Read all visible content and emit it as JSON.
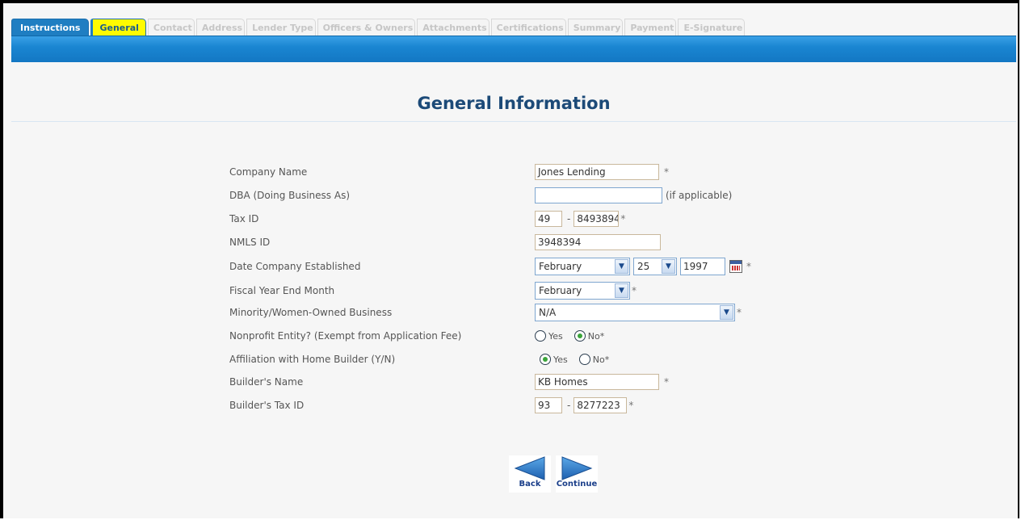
{
  "tabs": [
    {
      "label": "Instructions",
      "state": "enabled"
    },
    {
      "label": "General",
      "state": "current"
    },
    {
      "label": "Contact",
      "state": "disabled"
    },
    {
      "label": "Address",
      "state": "disabled"
    },
    {
      "label": "Lender Type",
      "state": "disabled"
    },
    {
      "label": "Officers & Owners",
      "state": "disabled"
    },
    {
      "label": "Attachments",
      "state": "disabled"
    },
    {
      "label": "Certifications",
      "state": "disabled"
    },
    {
      "label": "Summary",
      "state": "disabled"
    },
    {
      "label": "Payment",
      "state": "disabled"
    },
    {
      "label": "E-Signature",
      "state": "disabled"
    }
  ],
  "page_title": "General Information",
  "form": {
    "company_name": {
      "label": "Company Name",
      "value": "Jones Lending",
      "required": "*"
    },
    "dba": {
      "label": "DBA (Doing Business As)",
      "value": "",
      "hint": "(if applicable)"
    },
    "tax_id": {
      "label": "Tax ID",
      "part1": "49",
      "separator": "-",
      "part2": "8493894",
      "required": "*"
    },
    "nmls_id": {
      "label": "NMLS ID",
      "value": "3948394"
    },
    "date_established": {
      "label": "Date Company Established",
      "month": "February",
      "day": "25",
      "year": "1997",
      "required": "*"
    },
    "fiscal_year_end": {
      "label": "Fiscal Year End Month",
      "value": "February",
      "required": "*"
    },
    "minority_owned": {
      "label": "Minority/Women-Owned Business",
      "value": "N/A",
      "required": "*"
    },
    "nonprofit": {
      "label": "Nonprofit Entity? (Exempt from Application Fee)",
      "yes": "Yes",
      "no": "No*",
      "selected": "No"
    },
    "affiliation": {
      "label": "Affiliation with Home Builder (Y/N)",
      "yes": "Yes",
      "no": "No*",
      "selected": "Yes"
    },
    "builder_name": {
      "label": "Builder's Name",
      "value": "KB Homes",
      "required": "*"
    },
    "builder_tax_id": {
      "label": "Builder's Tax ID",
      "part1": "93",
      "separator": "-",
      "part2": "8277223",
      "required": "*"
    }
  },
  "nav": {
    "back_label": "Back",
    "continue_label": "Continue"
  },
  "colors": {
    "tab_blue": "#1f7ec2",
    "tab_current": "#fffb00",
    "title": "#1c4a78",
    "band": "#1a86d2"
  },
  "icons": {
    "calendar": "calendar-icon",
    "back": "left-arrow-icon",
    "continue": "right-arrow-icon",
    "dropdown": "chevron-down-icon"
  }
}
